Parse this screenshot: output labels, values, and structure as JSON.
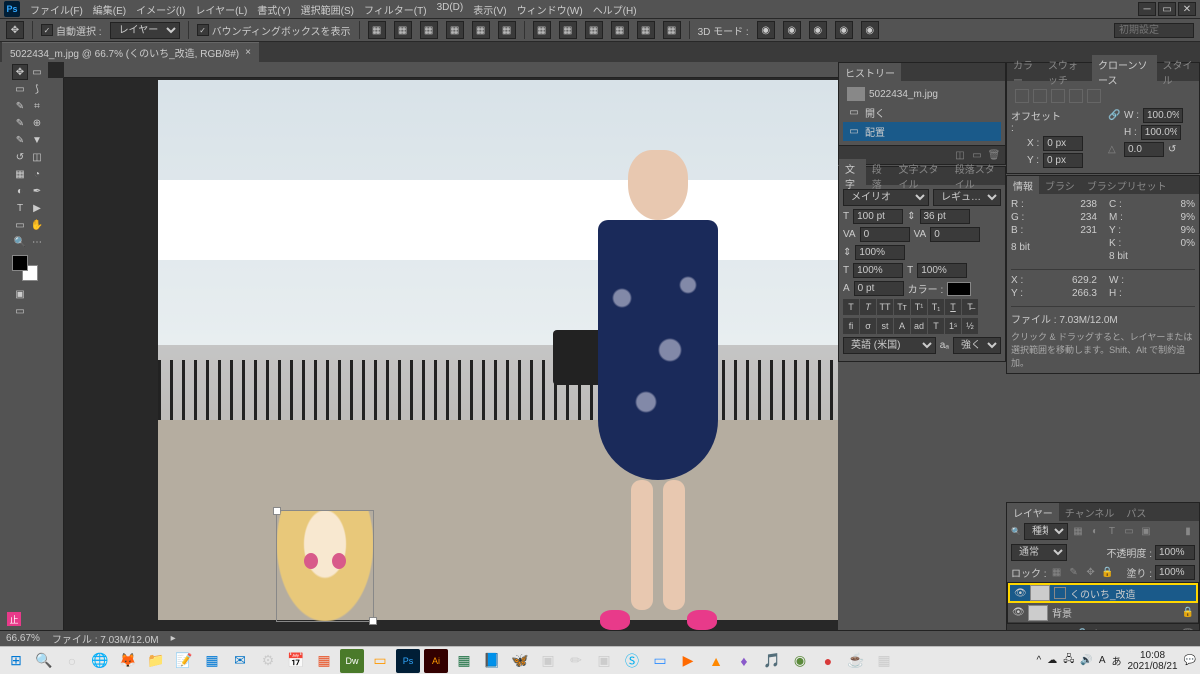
{
  "menu": {
    "items": [
      "ファイル(F)",
      "編集(E)",
      "イメージ(I)",
      "レイヤー(L)",
      "書式(Y)",
      "選択範囲(S)",
      "フィルター(T)",
      "3D(D)",
      "表示(V)",
      "ウィンドウ(W)",
      "ヘルプ(H)"
    ]
  },
  "options": {
    "auto_select_label": "自動選択 :",
    "auto_select_value": "レイヤー",
    "bbox_label": "バウンディングボックスを表示",
    "mode3d_label": "3D モード :"
  },
  "doc": {
    "tab_title": "5022434_m.jpg @ 66.7% (くのいち_改造, RGB/8#)"
  },
  "history": {
    "panel_title": "ヒストリー",
    "file_name": "5022434_m.jpg",
    "items": [
      "開く",
      "配置"
    ]
  },
  "char_panel": {
    "tabs": [
      "文字",
      "段落",
      "文字スタイル",
      "段落スタイル"
    ],
    "font": "メイリオ",
    "weight": "レギュ…",
    "size": "100 pt",
    "leading": "36 pt",
    "tracking": "0",
    "kerning": "0",
    "scale_v": "100%",
    "scale_h": "100%",
    "baseline": "0 pt",
    "color_label": "カラー :",
    "lang_label": "英語 (米国)",
    "aa_label": "強く"
  },
  "right_panels": {
    "tabs1": [
      "カラー",
      "スウォッチ",
      "クローンソース",
      "スタイル"
    ]
  },
  "clone_source": {
    "offset_label": "オフセット :",
    "x_label": "X :",
    "x_value": "0 px",
    "y_label": "Y :",
    "y_value": "0 px",
    "w_label": "W :",
    "w_value": "100.0%",
    "h_label": "H :",
    "h_value": "100.0%",
    "angle": "0.0"
  },
  "info": {
    "tabs": [
      "情報",
      "ブラシ",
      "ブラシプリセット"
    ],
    "R": "R :",
    "R_val": "238",
    "C": "C :",
    "C_val": "8%",
    "G": "G :",
    "G_val": "234",
    "M": "M :",
    "M_val": "9%",
    "B": "B :",
    "B_val": "231",
    "Y": "Y :",
    "Y_val": "9%",
    "K": "K :",
    "K_val": "0%",
    "bit1": "8 bit",
    "bit2": "8 bit",
    "X": "X :",
    "X_val": "629.2",
    "W": "W :",
    "Yc": "Y :",
    "Yc_val": "266.3",
    "H": "H :",
    "filesize_label": "ファイル :",
    "filesize": "7.03M/12.0M",
    "hint": "クリック & ドラッグすると、レイヤーまたは選択範囲を移動します。Shift、Alt で制約追加。"
  },
  "layers": {
    "tabs": [
      "レイヤー",
      "チャンネル",
      "パス"
    ],
    "kind_label": "種類",
    "blend": "通常",
    "opacity_label": "不透明度 :",
    "opacity": "100%",
    "lock_label": "ロック :",
    "fill_label": "塗り :",
    "fill": "100%",
    "items": [
      {
        "name": "くのいち_改造",
        "selected": true
      },
      {
        "name": "背景",
        "selected": false,
        "locked": true
      }
    ]
  },
  "search_placeholder": "初期設定",
  "status": {
    "zoom": "66.67%",
    "doc_label": "ファイル :",
    "doc_size": "7.03M/12.0M"
  },
  "taskbar": {
    "time": "10:08",
    "date": "2021/08/21"
  }
}
